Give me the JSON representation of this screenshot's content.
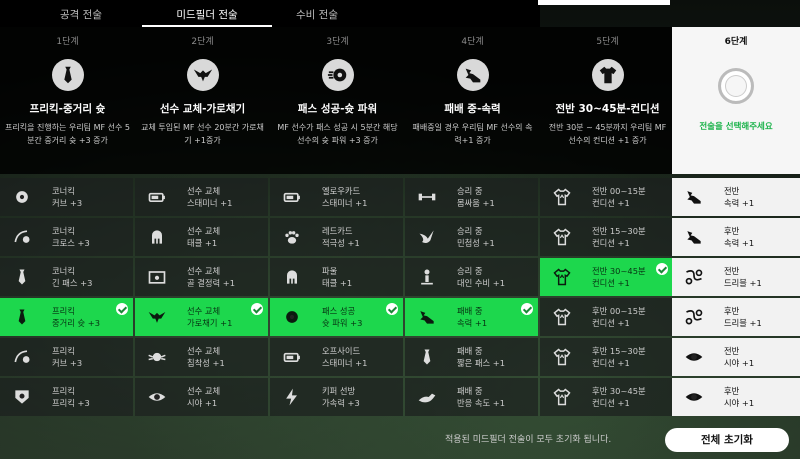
{
  "tabs": [
    {
      "label": "공격 전술",
      "active": false
    },
    {
      "label": "미드필더 전술",
      "active": true
    },
    {
      "label": "수비 전술",
      "active": false
    }
  ],
  "columns": [
    {
      "step": "1단계",
      "icon": "tie-icon",
      "title": "프리킥-중거리 슛",
      "desc": "프리킥을 진행하는 우리팀 MF 선수 5분간 중거리 슛 +3 증가"
    },
    {
      "step": "2단계",
      "icon": "eagle-icon",
      "title": "선수 교체-가로채기",
      "desc": "교체 투입된 MF 선수 20분간 가로채기 +1증가"
    },
    {
      "step": "3단계",
      "icon": "ball-icon",
      "title": "패스 성공-슛 파워",
      "desc": "MF 선수가 패스 성공 시 5분간 해당 선수의 슛 파워 +3 증가"
    },
    {
      "step": "4단계",
      "icon": "winged-boot-icon",
      "title": "패배 중-속력",
      "desc": "패배중일 경우 우리팀 MF 선수의 속력+1 증가"
    },
    {
      "step": "5단계",
      "icon": "jersey-icon",
      "title": "전반 30~45분-컨디션",
      "desc": "전반 30분 ~ 45분까지 우리팀 MF 선수의 컨디션 +1 증가"
    },
    {
      "step": "6단계",
      "prompt": "전술을 선택해주세요"
    }
  ],
  "cards": [
    [
      {
        "l1": "코너킥",
        "l2": "커브 +3",
        "icon": "ball-icon",
        "state": "normal"
      },
      {
        "l1": "코너킥",
        "l2": "크로스 +3",
        "icon": "ball-arc-icon",
        "state": "normal"
      },
      {
        "l1": "코너킥",
        "l2": "긴 패스 +3",
        "icon": "tie-icon",
        "state": "normal"
      },
      {
        "l1": "프리킥",
        "l2": "중거리 슛 +3",
        "icon": "tie-icon",
        "state": "selected"
      },
      {
        "l1": "프리킥",
        "l2": "커브 +3",
        "icon": "ball-arc-icon",
        "state": "normal"
      },
      {
        "l1": "프리킥",
        "l2": "프리킥 +3",
        "icon": "shield-ball-icon",
        "state": "normal"
      }
    ],
    [
      {
        "l1": "선수 교체",
        "l2": "스태미너 +1",
        "icon": "battery-icon",
        "state": "normal"
      },
      {
        "l1": "선수 교체",
        "l2": "태클 +1",
        "icon": "helmet-icon",
        "state": "normal"
      },
      {
        "l1": "선수 교체",
        "l2": "골 결정력 +1",
        "icon": "goal-icon",
        "state": "normal"
      },
      {
        "l1": "선수 교체",
        "l2": "가로채기 +1",
        "icon": "eagle-icon",
        "state": "selected"
      },
      {
        "l1": "선수 교체",
        "l2": "침착성 +1",
        "icon": "ball-wings-icon",
        "state": "normal"
      },
      {
        "l1": "선수 교체",
        "l2": "시야 +1",
        "icon": "eye-icon",
        "state": "normal"
      }
    ],
    [
      {
        "l1": "옐로우카드",
        "l2": "스태미너 +1",
        "icon": "battery-icon",
        "state": "normal"
      },
      {
        "l1": "레드카드",
        "l2": "적극성 +1",
        "icon": "paw-icon",
        "state": "normal"
      },
      {
        "l1": "파울",
        "l2": "태클 +1",
        "icon": "helmet-icon",
        "state": "normal"
      },
      {
        "l1": "패스 성공",
        "l2": "슛 파워 +3",
        "icon": "ball-icon",
        "state": "selected"
      },
      {
        "l1": "오프사이드",
        "l2": "스태미너 +1",
        "icon": "battery-icon",
        "state": "normal"
      },
      {
        "l1": "키퍼 선방",
        "l2": "가속력 +3",
        "icon": "lightning-icon",
        "state": "normal"
      }
    ],
    [
      {
        "l1": "승리 중",
        "l2": "몸싸움 +1",
        "icon": "dumbbell-icon",
        "state": "normal"
      },
      {
        "l1": "승리 중",
        "l2": "민첩성 +1",
        "icon": "bird-icon",
        "state": "normal"
      },
      {
        "l1": "승리 중",
        "l2": "대인 수비 +1",
        "icon": "person-icon",
        "state": "normal"
      },
      {
        "l1": "패배 중",
        "l2": "속력 +1",
        "icon": "winged-boot-icon",
        "state": "selected"
      },
      {
        "l1": "패배 중",
        "l2": "짧은 패스 +1",
        "icon": "tie-icon",
        "state": "normal"
      },
      {
        "l1": "패배 중",
        "l2": "반응 속도 +1",
        "icon": "cat-icon",
        "state": "normal"
      }
    ],
    [
      {
        "l1": "전반 00~15분",
        "l2": "컨디션 +1",
        "icon": "jersey-icon",
        "state": "normal"
      },
      {
        "l1": "전반 15~30분",
        "l2": "컨디션 +1",
        "icon": "jersey-icon",
        "state": "normal"
      },
      {
        "l1": "전반 30~45분",
        "l2": "컨디션 +1",
        "icon": "jersey-icon",
        "state": "selected"
      },
      {
        "l1": "후반 00~15분",
        "l2": "컨디션 +1",
        "icon": "jersey-icon",
        "state": "normal"
      },
      {
        "l1": "후반 15~30분",
        "l2": "컨디션 +1",
        "icon": "jersey-icon",
        "state": "normal"
      },
      {
        "l1": "후반 30~45분",
        "l2": "컨디션 +1",
        "icon": "jersey-icon",
        "state": "normal"
      }
    ],
    [
      {
        "l1": "전반",
        "l2": "속력 +1",
        "icon": "winged-boot-icon",
        "state": "light"
      },
      {
        "l1": "후반",
        "l2": "속력 +1",
        "icon": "winged-boot-icon",
        "state": "light"
      },
      {
        "l1": "전반",
        "l2": "드리블 +1",
        "icon": "dribble-icon",
        "state": "light"
      },
      {
        "l1": "후반",
        "l2": "드리블 +1",
        "icon": "dribble-icon",
        "state": "light"
      },
      {
        "l1": "전반",
        "l2": "시야 +1",
        "icon": "eye-icon",
        "state": "light"
      },
      {
        "l1": "후반",
        "l2": "시야 +1",
        "icon": "eye-icon",
        "state": "light"
      }
    ]
  ],
  "footer": {
    "message": "적용된 미드필더 전술이 모두 초기화 됩니다.",
    "reset_label": "전체 초기화"
  },
  "colors": {
    "selected": "#1dd74d",
    "prompt": "#1db34c"
  }
}
